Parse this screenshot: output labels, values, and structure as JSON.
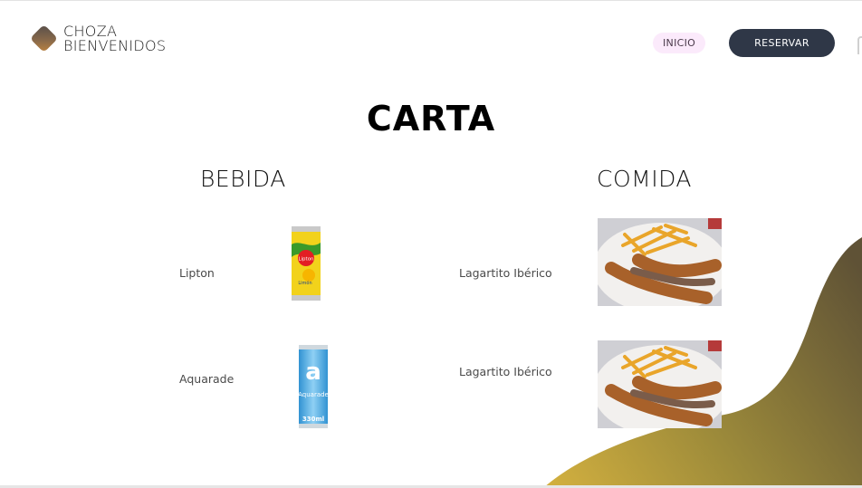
{
  "header": {
    "logo_line1": "CHOZA",
    "logo_line2": "BIENVENIDOS",
    "nav_inicio": "INICIO",
    "reservar_label": "RESERVAR"
  },
  "main": {
    "title": "CARTA",
    "bebida": {
      "title": "BEBIDA",
      "items": [
        {
          "name": "Lipton"
        },
        {
          "name": "Aquarade"
        }
      ]
    },
    "comida": {
      "title": "COMIDA",
      "items": [
        {
          "name": "Lagartito Ibérico"
        },
        {
          "name": "Lagartito Ibérico"
        }
      ]
    }
  },
  "images": {
    "lipton_brand": "Lipton",
    "lipton_flavor": "Limón",
    "aquarade_mark": "a",
    "aquarade_brand": "Aquarade",
    "aquarade_volume": "330ml"
  },
  "colors": {
    "reservar_bg": "#2f3747",
    "inicio_bg": "#fbeafb",
    "wave_start": "#d4b13f",
    "wave_end": "#5f5236"
  },
  "icons": {
    "logo": "diamond-logo-icon"
  }
}
